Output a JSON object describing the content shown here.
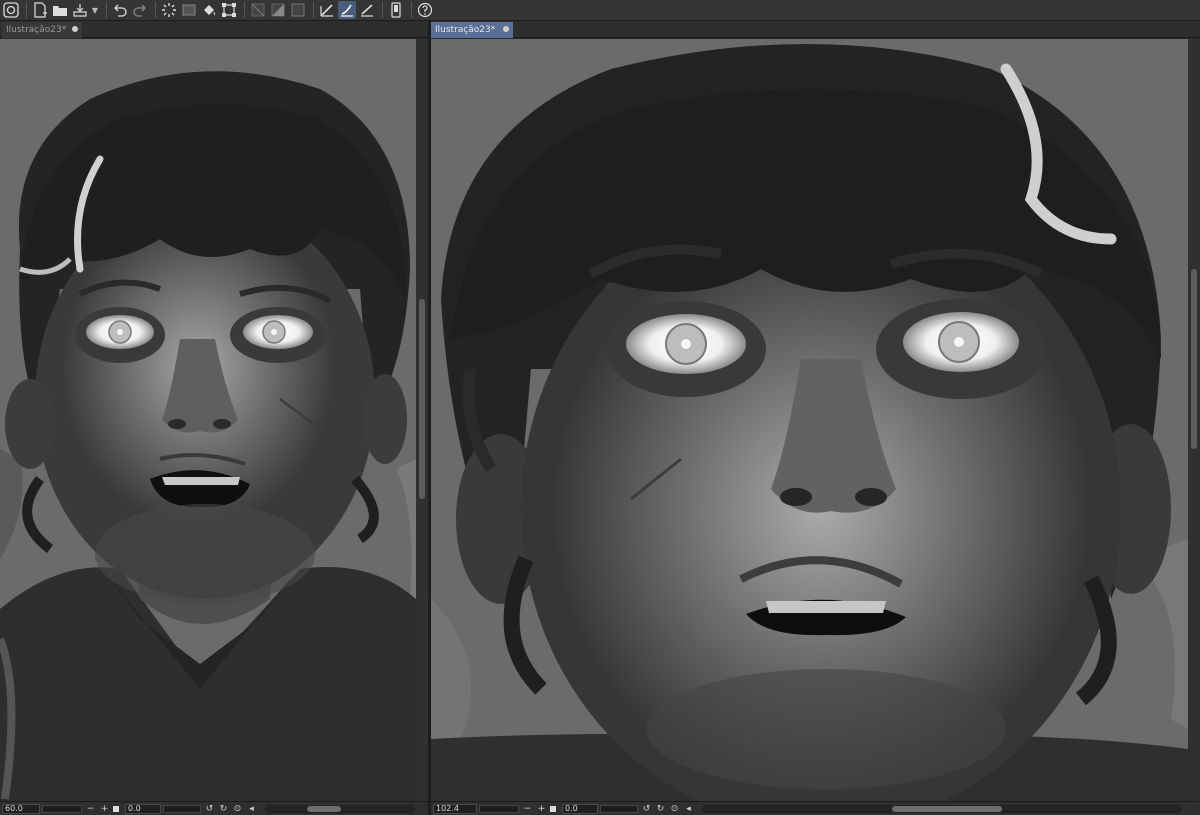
{
  "toolbar": {
    "icons": [
      "app-logo-icon",
      "new-file-icon",
      "open-folder-icon",
      "save-icon",
      "undo-icon",
      "redo-icon",
      "loading-spinner-icon",
      "clear-icon",
      "fill-icon",
      "transform-icon",
      "snap-off-icon",
      "snap-grid-icon",
      "snap-frame-icon",
      "ruler-snap-icon",
      "ruler-snap-curve-icon",
      "ruler-snap-line-icon",
      "device-icon",
      "help-icon"
    ]
  },
  "left_pane": {
    "tab": {
      "title": "Ilustração23*"
    },
    "status": {
      "zoom": "60.0",
      "angle": "0.0"
    }
  },
  "right_pane": {
    "tab": {
      "title": "Ilustração23*"
    },
    "status": {
      "zoom": "102.4",
      "angle": "0.0"
    }
  },
  "colors": {
    "canvas_bg": "#6b6b6b",
    "active_tab": "#5a6f95",
    "toolbar_bg": "#353535"
  }
}
